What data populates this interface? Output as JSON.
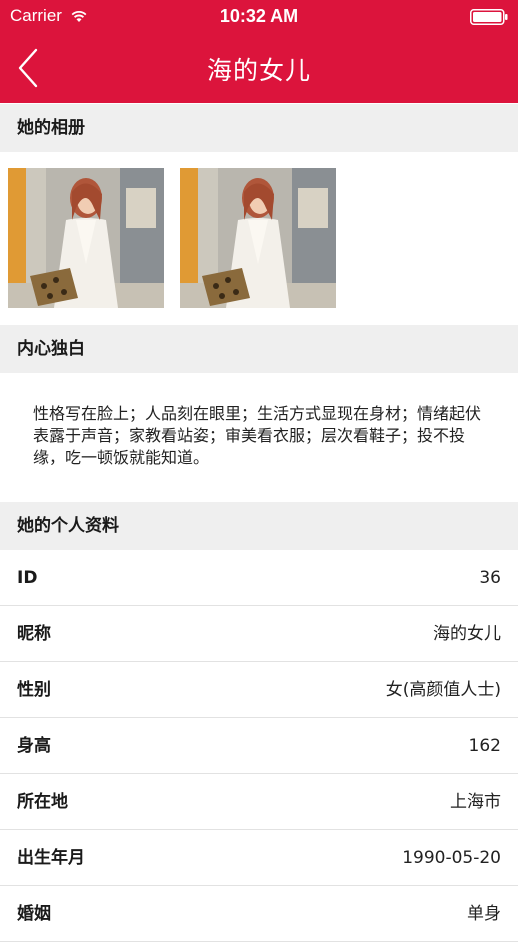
{
  "status_bar": {
    "carrier": "Carrier",
    "time": "10:32 AM"
  },
  "nav": {
    "title": "海的女儿",
    "back_icon": "chevron-left-icon"
  },
  "album": {
    "title": "她的相册",
    "photo_count": 2
  },
  "monologue": {
    "title": "内心独白",
    "text": "性格写在脸上；人品刻在眼里；生活方式显现在身材；情绪起伏表露于声音；家教看站姿；审美看衣服；层次看鞋子；投不投缘，吃一顿饭就能知道。"
  },
  "profile": {
    "title": "她的个人资料",
    "rows": [
      {
        "label": "ID",
        "value": "36"
      },
      {
        "label": "昵称",
        "value": "海的女儿"
      },
      {
        "label": "性别",
        "value": "女(高颜值人士)"
      },
      {
        "label": "身高",
        "value": "162"
      },
      {
        "label": "所在地",
        "value": "上海市"
      },
      {
        "label": "出生年月",
        "value": "1990-05-20"
      },
      {
        "label": "婚姻",
        "value": "单身"
      }
    ]
  },
  "colors": {
    "brand": "#dc143c",
    "section_bg": "#efefef"
  }
}
